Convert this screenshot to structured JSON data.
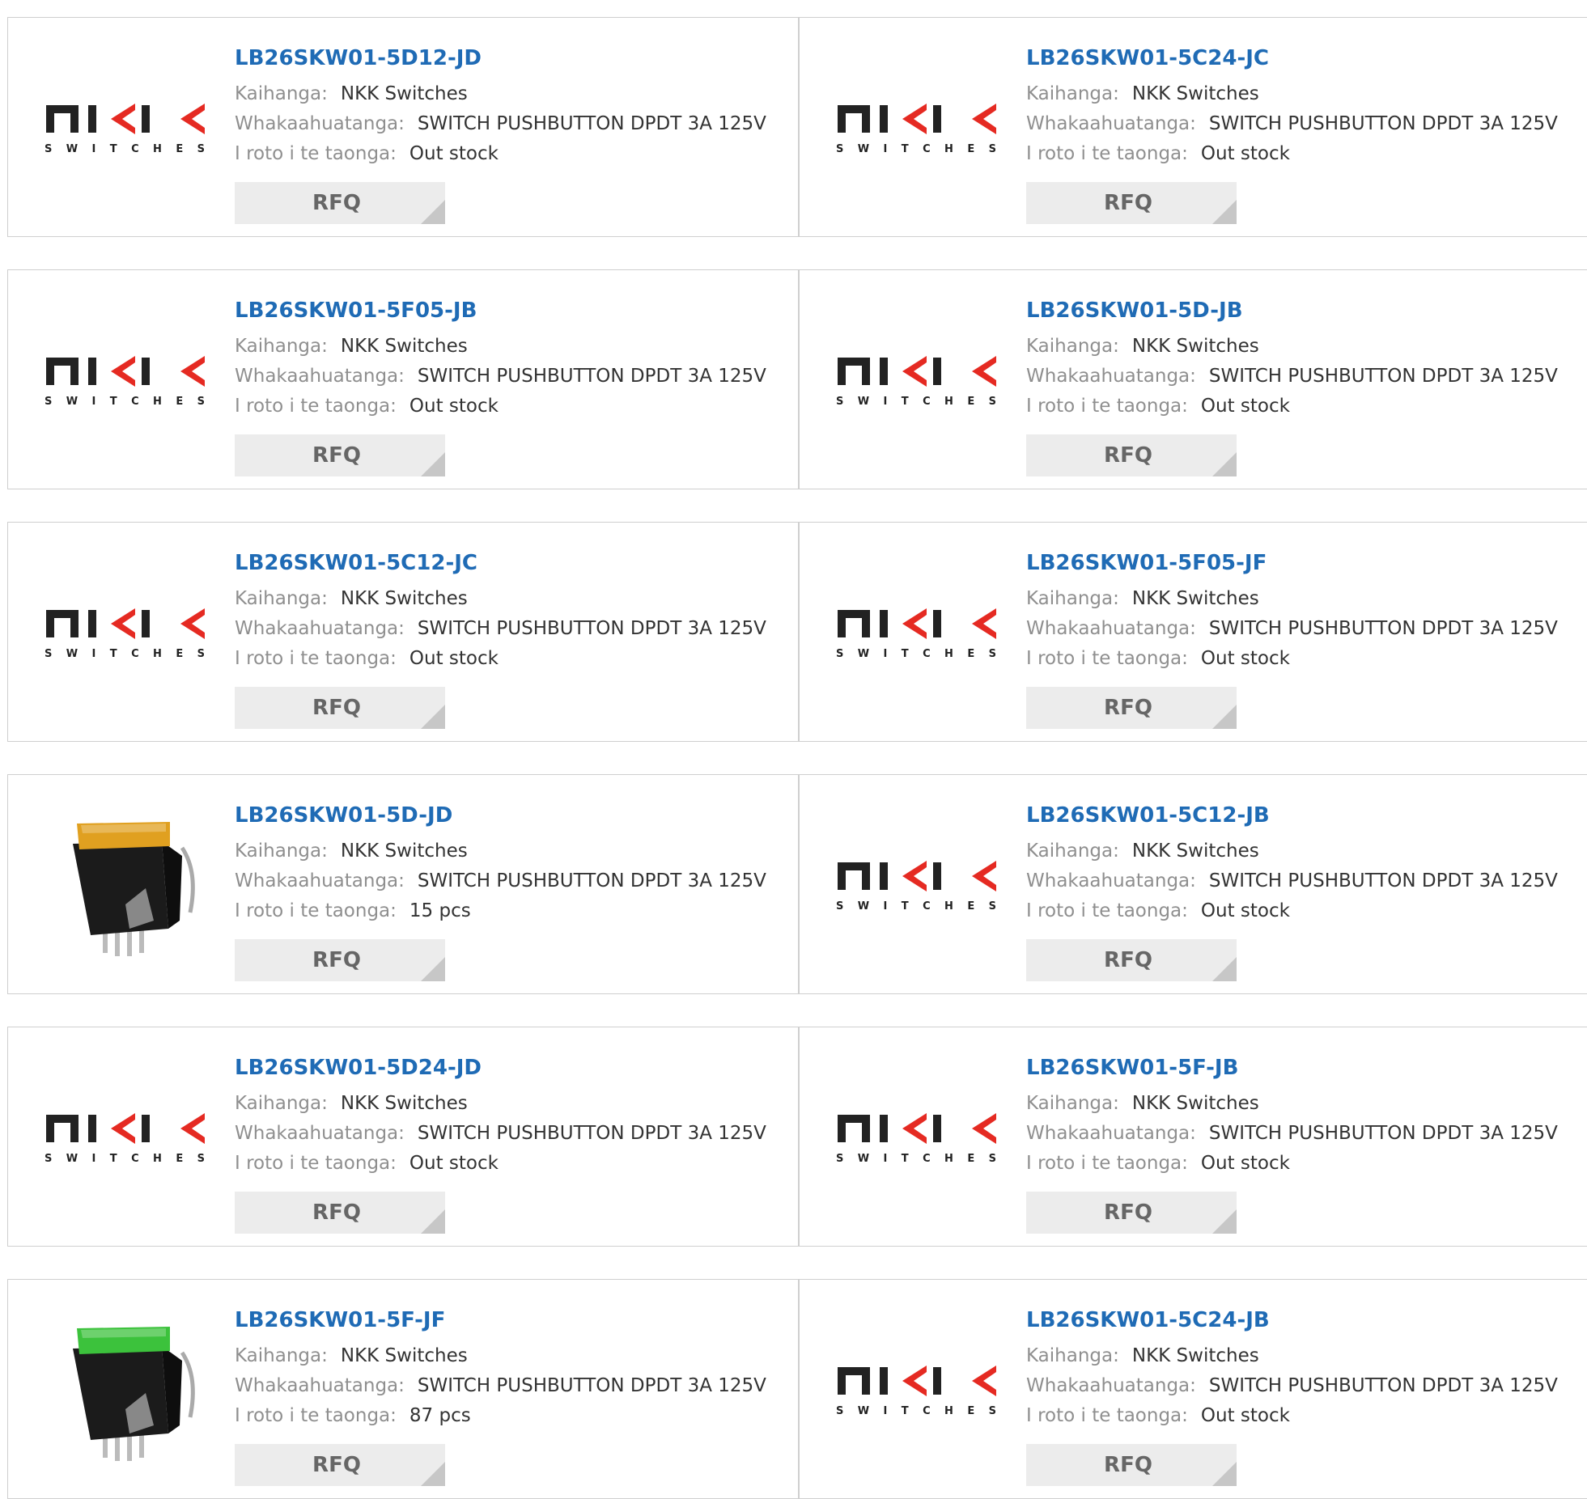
{
  "labels": {
    "manufacturer": "Kaihanga:",
    "description": "Whakaahuatanga:",
    "stock": "I roto i te taonga:",
    "rfq": "RFQ"
  },
  "logo": {
    "main": "NKK",
    "sub": "SWITCHES"
  },
  "colors": {
    "link": "#1f6bb5",
    "label": "#8f8f8f",
    "value": "#333333",
    "button": "#ececec"
  },
  "products": [
    {
      "part": "LB26SKW01-5D12-JD",
      "manufacturer": "NKK Switches",
      "description": "SWITCH PUSHBUTTON DPDT 3A 125V",
      "stock": "Out stock",
      "image": "nkk-logo"
    },
    {
      "part": "LB26SKW01-5C24-JC",
      "manufacturer": "NKK Switches",
      "description": "SWITCH PUSHBUTTON DPDT 3A 125V",
      "stock": "Out stock",
      "image": "nkk-logo"
    },
    {
      "part": "LB26SKW01-5F05-JB",
      "manufacturer": "NKK Switches",
      "description": "SWITCH PUSHBUTTON DPDT 3A 125V",
      "stock": "Out stock",
      "image": "nkk-logo"
    },
    {
      "part": "LB26SKW01-5D-JB",
      "manufacturer": "NKK Switches",
      "description": "SWITCH PUSHBUTTON DPDT 3A 125V",
      "stock": "Out stock",
      "image": "nkk-logo"
    },
    {
      "part": "LB26SKW01-5C12-JC",
      "manufacturer": "NKK Switches",
      "description": "SWITCH PUSHBUTTON DPDT 3A 125V",
      "stock": "Out stock",
      "image": "nkk-logo"
    },
    {
      "part": "LB26SKW01-5F05-JF",
      "manufacturer": "NKK Switches",
      "description": "SWITCH PUSHBUTTON DPDT 3A 125V",
      "stock": "Out stock",
      "image": "nkk-logo"
    },
    {
      "part": "LB26SKW01-5D-JD",
      "manufacturer": "NKK Switches",
      "description": "SWITCH PUSHBUTTON DPDT 3A 125V",
      "stock": "15 pcs",
      "image": "switch-photo",
      "cap_color": "#e0a020"
    },
    {
      "part": "LB26SKW01-5C12-JB",
      "manufacturer": "NKK Switches",
      "description": "SWITCH PUSHBUTTON DPDT 3A 125V",
      "stock": "Out stock",
      "image": "nkk-logo"
    },
    {
      "part": "LB26SKW01-5D24-JD",
      "manufacturer": "NKK Switches",
      "description": "SWITCH PUSHBUTTON DPDT 3A 125V",
      "stock": "Out stock",
      "image": "nkk-logo"
    },
    {
      "part": "LB26SKW01-5F-JB",
      "manufacturer": "NKK Switches",
      "description": "SWITCH PUSHBUTTON DPDT 3A 125V",
      "stock": "Out stock",
      "image": "nkk-logo"
    },
    {
      "part": "LB26SKW01-5F-JF",
      "manufacturer": "NKK Switches",
      "description": "SWITCH PUSHBUTTON DPDT 3A 125V",
      "stock": "87 pcs",
      "image": "switch-photo",
      "cap_color": "#3cc23c"
    },
    {
      "part": "LB26SKW01-5C24-JB",
      "manufacturer": "NKK Switches",
      "description": "SWITCH PUSHBUTTON DPDT 3A 125V",
      "stock": "Out stock",
      "image": "nkk-logo"
    }
  ]
}
